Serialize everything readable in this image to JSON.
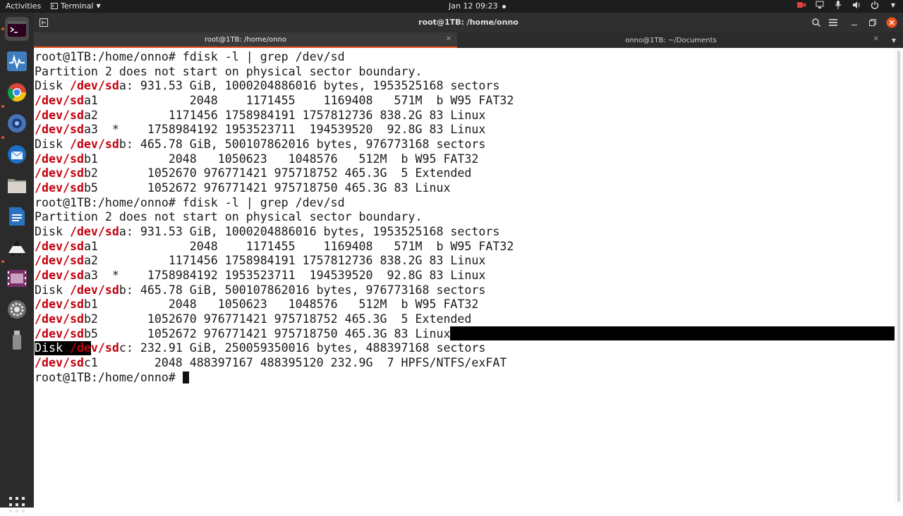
{
  "topbar": {
    "activities": "Activities",
    "app_menu": "Terminal",
    "clock": "Jan 12  09:23"
  },
  "window": {
    "title": "root@1TB: /home/onno"
  },
  "tabs": [
    {
      "label": "root@1TB: /home/onno",
      "active": true
    },
    {
      "label": "onno@1TB: ~/Documents",
      "active": false
    }
  ],
  "dock": {
    "items": [
      "terminal",
      "system-monitor",
      "chrome",
      "cheese",
      "thunderbird",
      "files",
      "libreoffice-writer",
      "inkscape",
      "screen-recorder",
      "settings",
      "usb-drive"
    ]
  },
  "terminal": {
    "lines": [
      [
        "root@1TB:/home/onno# fdisk -l | grep /dev/sd"
      ],
      [
        "Partition 2 does not start on physical sector boundary."
      ],
      [
        "Disk ",
        "/dev/sd",
        "a: 931.53 GiB, 1000204886016 bytes, 1953525168 sectors"
      ],
      [
        "/dev/sd",
        "a1             2048    1171455    1169408   571M  b W95 FAT32"
      ],
      [
        "/dev/sd",
        "a2          1171456 1758984191 1757812736 838.2G 83 Linux"
      ],
      [
        "/dev/sd",
        "a3  *    1758984192 1953523711  194539520  92.8G 83 Linux"
      ],
      [
        "Disk ",
        "/dev/sd",
        "b: 465.78 GiB, 500107862016 bytes, 976773168 sectors"
      ],
      [
        "/dev/sd",
        "b1          2048   1050623   1048576   512M  b W95 FAT32"
      ],
      [
        "/dev/sd",
        "b2       1052670 976771421 975718752 465.3G  5 Extended"
      ],
      [
        "/dev/sd",
        "b5       1052672 976771421 975718750 465.3G 83 Linux"
      ],
      [
        "root@1TB:/home/onno# fdisk -l | grep /dev/sd"
      ],
      [
        "Partition 2 does not start on physical sector boundary."
      ],
      [
        "Disk ",
        "/dev/sd",
        "a: 931.53 GiB, 1000204886016 bytes, 1953525168 sectors"
      ],
      [
        "/dev/sd",
        "a1             2048    1171455    1169408   571M  b W95 FAT32"
      ],
      [
        "/dev/sd",
        "a2          1171456 1758984191 1757812736 838.2G 83 Linux"
      ],
      [
        "/dev/sd",
        "a3  *    1758984192 1953523711  194539520  92.8G 83 Linux"
      ],
      [
        "Disk ",
        "/dev/sd",
        "b: 465.78 GiB, 500107862016 bytes, 976773168 sectors"
      ],
      [
        "/dev/sd",
        "b1          2048   1050623   1048576   512M  b W95 FAT32"
      ],
      [
        "/dev/sd",
        "b2       1052670 976771421 975718752 465.3G  5 Extended"
      ],
      [
        "/dev/sd",
        "b5       1052672 976771421 975718750 465.3G 83 Linux"
      ],
      [
        "Disk ",
        "/dev/sd",
        "c: 232.91 GiB, 250059350016 bytes, 488397168 sectors"
      ],
      [
        "/dev/sd",
        "c1        2048 488397167 488395120 232.9G  7 HPFS/NTFS/exFAT"
      ],
      [
        "root@1TB:/home/onno# "
      ]
    ]
  }
}
